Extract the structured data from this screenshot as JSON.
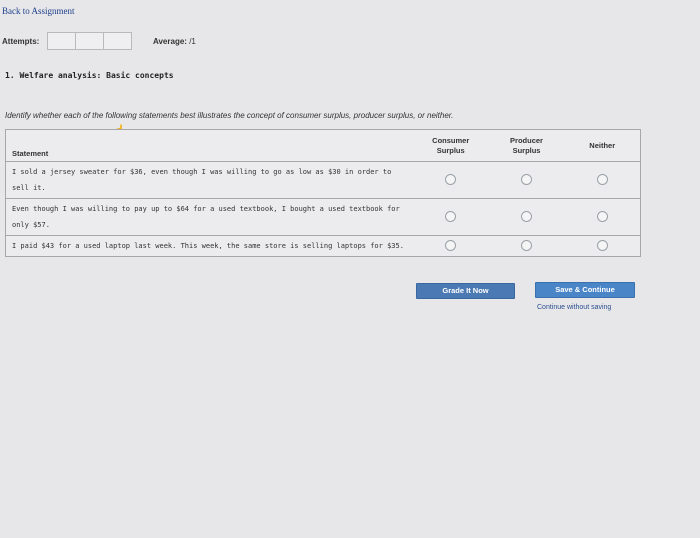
{
  "nav": {
    "back_link": "Back to Assignment"
  },
  "status": {
    "attempts_label": "Attempts:",
    "average_label": "Average:",
    "average_value": "/1"
  },
  "question": {
    "title": "1. Welfare analysis: Basic concepts",
    "instructions": "Identify whether each of the following statements best illustrates the concept of consumer surplus, producer surplus, or neither."
  },
  "table": {
    "headers": {
      "statement": "Statement",
      "consumer_line1": "Consumer",
      "consumer_line2": "Surplus",
      "producer_line1": "Producer",
      "producer_line2": "Surplus",
      "neither": "Neither"
    },
    "rows": [
      {
        "statement": "I sold a jersey sweater for $36, even though I was willing to go as low as $30 in order to sell it."
      },
      {
        "statement": "Even though I was willing to pay up to $64 for a used textbook, I bought a used textbook for only $57."
      },
      {
        "statement": "I paid $43 for a used laptop last week. This week, the same store is selling laptops for $35."
      }
    ]
  },
  "actions": {
    "grade_label": "Grade It Now",
    "save_label": "Save & Continue",
    "continue_label": "Continue without saving"
  },
  "colors": {
    "background": "#e7e7e9",
    "button_blue": "#4a79b3",
    "link_blue": "#1d3f8a"
  }
}
